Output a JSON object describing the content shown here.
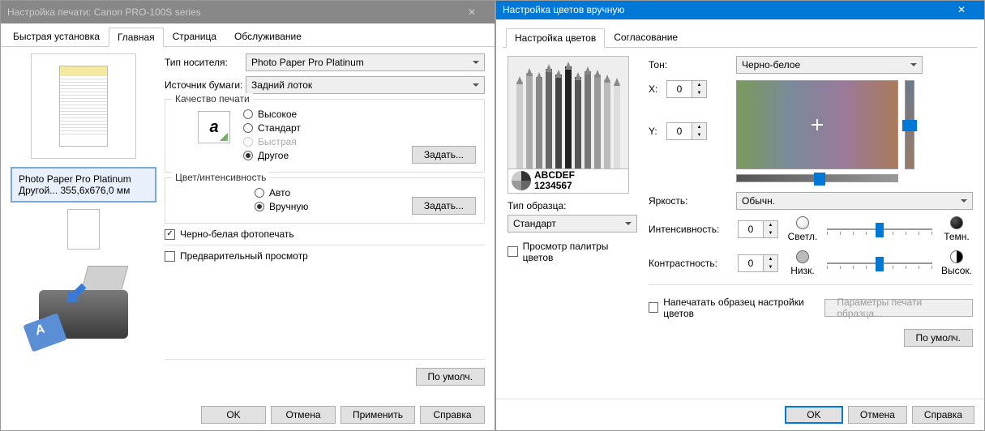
{
  "left": {
    "title": "Настройка печати: Canon PRO-100S series",
    "tabs": [
      "Быстрая установка",
      "Главная",
      "Страница",
      "Обслуживание"
    ],
    "active_tab": 1,
    "media_label": "Тип носителя:",
    "media_value": "Photo Paper Pro Platinum",
    "source_label": "Источник бумаги:",
    "source_value": "Задний лоток",
    "quality": {
      "legend": "Качество печати",
      "options": [
        "Высокое",
        "Стандарт",
        "Быстрая",
        "Другое"
      ],
      "disabled_index": 2,
      "selected_index": 3,
      "set_btn": "Задать..."
    },
    "color_intensity": {
      "legend": "Цвет/интенсивность",
      "options": [
        "Авто",
        "Вручную"
      ],
      "selected_index": 1,
      "set_btn": "Задать..."
    },
    "bw_checkbox": "Черно-белая фотопечать",
    "preview_checkbox": "Предварительный просмотр",
    "info_line1": "Photo Paper Pro Platinum",
    "info_line2": "Другой... 355,6x676,0 мм",
    "default_btn": "По умолч.",
    "ok": "OK",
    "cancel": "Отмена",
    "apply": "Применить",
    "help": "Справка"
  },
  "right": {
    "title": "Настройка цветов вручную",
    "tabs": [
      "Настройка цветов",
      "Согласование"
    ],
    "active_tab": 0,
    "sample_text1": "ABCDEF",
    "sample_text2": "1234567",
    "sample_type_label": "Тип образца:",
    "sample_type_value": "Стандарт",
    "palette_checkbox": "Просмотр палитры цветов",
    "tone_label": "Тон:",
    "tone_value": "Черно-белое",
    "x_label": "X:",
    "x_value": "0",
    "y_label": "Y:",
    "y_value": "0",
    "brightness_label": "Яркость:",
    "brightness_value": "Обычн.",
    "intensity_label": "Интенсивность:",
    "intensity_value": "0",
    "intensity_left": "Светл.",
    "intensity_right": "Темн.",
    "contrast_label": "Контрастность:",
    "contrast_value": "0",
    "contrast_left": "Низк.",
    "contrast_right": "Высок.",
    "print_sample_checkbox": "Напечатать образец настройки цветов",
    "print_sample_params_btn": "Параметры печати образца...",
    "default_btn": "По умолч.",
    "ok": "OK",
    "cancel": "Отмена",
    "help": "Справка"
  }
}
